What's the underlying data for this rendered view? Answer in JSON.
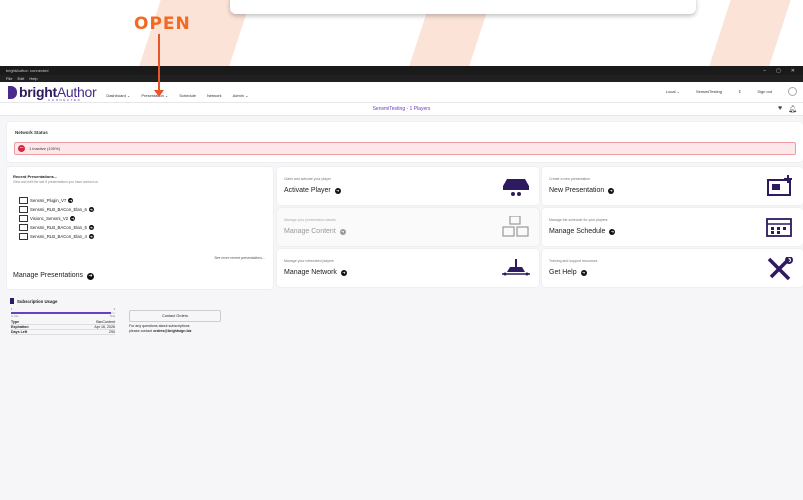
{
  "overlay": {
    "open_label": "OPEN"
  },
  "window": {
    "title": "brightAuthor: connected",
    "menu": [
      "File",
      "Edit",
      "Help"
    ]
  },
  "logo": {
    "main": "bright",
    "accent": "Author",
    "sub": "CONNECTED"
  },
  "nav": {
    "links": [
      "Dashboard ⌄",
      "Presentation ⌄",
      "Schedule",
      "Network",
      "Admin ⌄"
    ],
    "local": "Local",
    "network_name": "SensmiTesting",
    "sign_out": "Sign out"
  },
  "subheader": {
    "text": "SensmiTesting - 1 Players"
  },
  "network_status": {
    "title": "Network Status",
    "status_text": "1 inactive (100%)"
  },
  "recent": {
    "title": "Recent Presentations...",
    "subtitle": "View and edit the last 5 presentations you have worked on",
    "items": [
      "Sensmi_Plugin_V7",
      "Sensmi_RLB_BACon_Elan_6",
      "Visionc_Sensmi_V2",
      "Sensmi_RLB_BACon_Elan_5",
      "Sensmi_RLB_BACon_Elan_4"
    ],
    "see_more": "See more recent presentations...",
    "manage": "Manage Presentations"
  },
  "tiles": [
    {
      "sub": "Claim and activate your player",
      "title": "Activate Player",
      "icon": "player-device-icon",
      "enabled": true
    },
    {
      "sub": "Create a new presentation",
      "title": "New Presentation",
      "icon": "presentation-icon",
      "enabled": true
    },
    {
      "sub": "Manage your presentation assets",
      "title": "Manage Content",
      "icon": "content-icon",
      "enabled": false
    },
    {
      "sub": "Manage the schedule for your players",
      "title": "Manage Schedule",
      "icon": "calendar-icon",
      "enabled": true
    },
    {
      "sub": "Manage your networked players",
      "title": "Manage Network",
      "icon": "network-icon",
      "enabled": true
    },
    {
      "sub": "Training and support resources",
      "title": "Get Help",
      "icon": "tools-icon",
      "enabled": true
    }
  ],
  "subscription": {
    "title": "Subscription Usage",
    "bar_left": "In Use",
    "bar_right": "Total",
    "bar_left_val": "1",
    "bar_right_val": "1",
    "usage_fraction": 0.96,
    "rows": [
      {
        "k": "Type",
        "v": "BsnContent"
      },
      {
        "k": "Expiration",
        "v": "Apr 16, 2026"
      },
      {
        "k": "Days Left",
        "v": "290"
      }
    ],
    "contact_button": "Contact Orders",
    "contact_text_1": "For any questions about subscriptions",
    "contact_text_2": "please contact ",
    "contact_email": "orders@brightsign.biz"
  },
  "colors": {
    "accent": "#6a3fc0",
    "brand": "#2e1a5e",
    "open": "#f26a21",
    "error": "#d7263d"
  }
}
